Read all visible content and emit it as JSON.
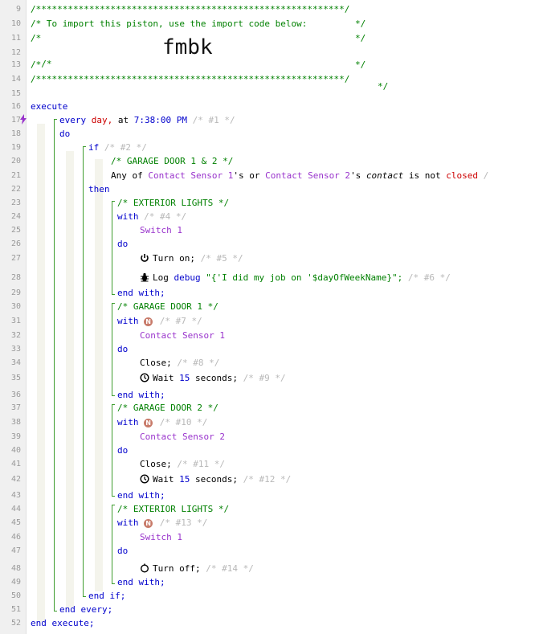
{
  "line_numbers": [
    "9",
    "10",
    "11",
    "12",
    "13",
    "14",
    "15",
    "16",
    "17",
    "18",
    "19",
    "20",
    "21",
    "22",
    "23",
    "24",
    "25",
    "26",
    "27",
    "28",
    "29",
    "30",
    "31",
    "32",
    "33",
    "34",
    "35",
    "36",
    "37",
    "38",
    "39",
    "40",
    "41",
    "42",
    "43",
    "44",
    "45",
    "46",
    "47",
    "48",
    "49",
    "50",
    "51",
    "52"
  ],
  "header": {
    "border": "/**********************************************************/",
    "line10": "/* To import this piston, use the import code below:         */",
    "line11": "/*                                                           */",
    "line12_left": "/*",
    "line12_right": "*/",
    "line13": "/*                                                           */",
    "import_code": "fmbk"
  },
  "kw": {
    "execute": "execute",
    "end_execute": "end execute;",
    "do": "do",
    "if": "if",
    "then": "then",
    "end_if": "end if;",
    "end_every": "end every;",
    "with": "with",
    "end_with": "end with;"
  },
  "trigger": {
    "every": "every",
    "unit": "day,",
    "at": "at",
    "time": "7:38:00 PM",
    "id": "/* #1 */"
  },
  "condition": {
    "id": "/* #2 */",
    "comment": "/* GARAGE DOOR 1 & 2 */",
    "any_of": "Any of",
    "device1": "Contact Sensor 1",
    "poss": "'s or",
    "device2": "Contact Sensor 2",
    "poss2": "'s",
    "attribute": "contact",
    "op": "is not",
    "value": "closed",
    "tail": "/"
  },
  "block1": {
    "comment": "/* EXTERIOR LIGHTS */",
    "with_id": "/* #4 */",
    "device": "Switch 1",
    "cmd1": "Turn on;",
    "cmd1_id": "/* #5 */",
    "log": "Log",
    "log_level": "debug",
    "log_text": "\"{'I did my job on '$dayOfWeekName}\";",
    "log_id": "/* #6 */"
  },
  "block2": {
    "comment": "/* GARAGE DOOR 1 */",
    "badge": "N",
    "with_id": "/* #7 */",
    "device": "Contact Sensor 1",
    "cmd1": "Close;",
    "cmd1_id": "/* #8 */",
    "wait": "Wait",
    "wait_num": "15",
    "wait_unit": "seconds;",
    "wait_id": "/* #9 */"
  },
  "block3": {
    "comment": "/* GARAGE DOOR 2 */",
    "badge": "N",
    "with_id": "/* #10 */",
    "device": "Contact Sensor 2",
    "cmd1": "Close;",
    "cmd1_id": "/* #11 */",
    "wait": "Wait",
    "wait_num": "15",
    "wait_unit": "seconds;",
    "wait_id": "/* #12 */"
  },
  "block4": {
    "comment": "/* EXTERIOR LIGHTS */",
    "badge": "N",
    "with_id": "/* #13 */",
    "device": "Switch 1",
    "cmd1": "Turn off;",
    "cmd1_id": "/* #14 */"
  },
  "colors": {
    "comment": "#008000",
    "keyword": "#0000cc",
    "variable": "#9933cc",
    "guide": "#3f9d2f",
    "badge": "#c87b6a"
  }
}
